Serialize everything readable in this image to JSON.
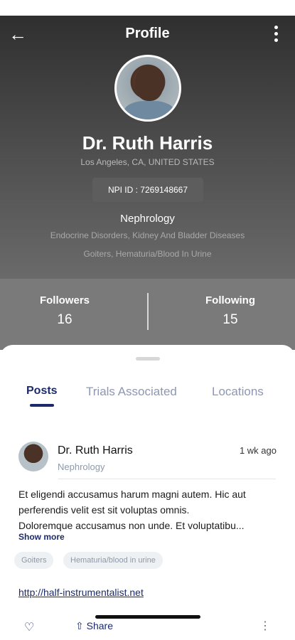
{
  "header": {
    "title": "Profile",
    "back_icon": "arrow-left-icon",
    "menu_icon": "kebab-vertical-icon"
  },
  "profile": {
    "name": "Dr. Ruth Harris",
    "location": "Los Angeles, CA, UNITED STATES",
    "npi": "NPI ID : 7269148667",
    "specialty": "Nephrology",
    "subspecialties_line1": "Endocrine Disorders, Kidney And Bladder Diseases",
    "subspecialties_line2": "Goiters, Hematuria/Blood In Urine"
  },
  "stats": {
    "followers_label": "Followers",
    "followers_value": "16",
    "following_label": "Following",
    "following_value": "15"
  },
  "tabs": [
    {
      "label": "Posts",
      "active": true
    },
    {
      "label": "Trials Associated",
      "active": false
    },
    {
      "label": "Locations",
      "active": false
    }
  ],
  "post": {
    "author": "Dr. Ruth Harris",
    "specialty": "Nephrology",
    "time": "1 wk ago",
    "body_lines": [
      "Et eligendi accusamus harum magni autem. Hic aut",
      "perferendis velit est sit voluptas omnis.",
      "Doloremque accusamus non unde. Et voluptatibu..."
    ],
    "show_more": "Show more",
    "tags": [
      "Goiters",
      "Hematuria/blood in urine"
    ],
    "link": "http://half-instrumentalist.net",
    "share_label": "Share"
  },
  "colors": {
    "accent": "#1c2a6b",
    "header_dark": "#2f2f2f",
    "stats_bg": "#7a7a7a"
  }
}
